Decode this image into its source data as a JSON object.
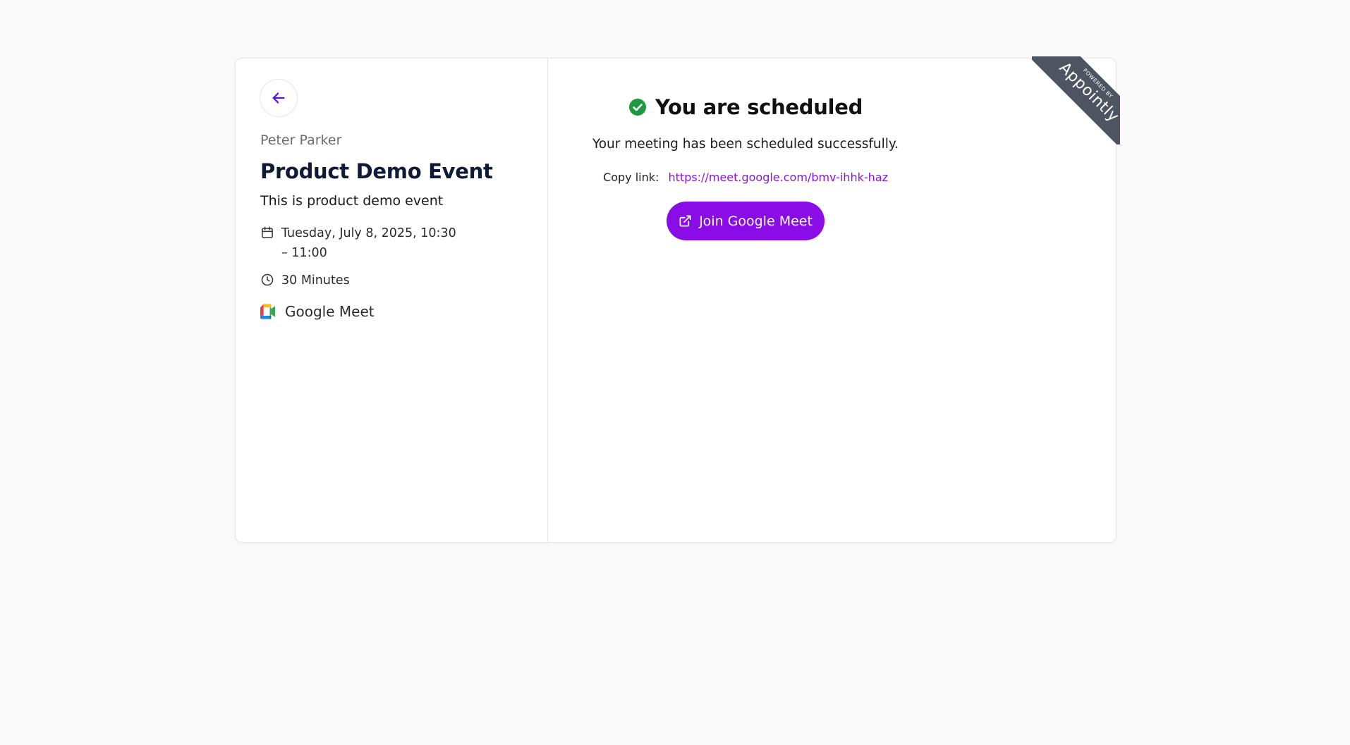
{
  "event": {
    "host": "Peter Parker",
    "title": "Product Demo Event",
    "description": "This is product demo event",
    "date_line1": "Tuesday, July 8, 2025, 10:30",
    "date_line2": "– 11:00",
    "duration": "30 Minutes",
    "location": "Google Meet"
  },
  "confirmation": {
    "title": "You are scheduled",
    "message": "Your meeting has been scheduled successfully.",
    "copy_label": "Copy link:",
    "link": "https://meet.google.com/bmv-ihhk-haz",
    "join_label": "Join Google Meet"
  },
  "ribbon": {
    "small": "POWERED BY",
    "brand": "Appointly"
  },
  "colors": {
    "accent": "#8a0ce6",
    "link": "#8c14d8",
    "success": "#1e9a3e",
    "ribbon": "#4d5563"
  },
  "icons": {
    "back": "arrow-left-icon",
    "date": "calendar-icon",
    "duration": "clock-icon",
    "location": "google-meet-icon",
    "success": "check-circle-icon",
    "join": "external-link-icon"
  }
}
